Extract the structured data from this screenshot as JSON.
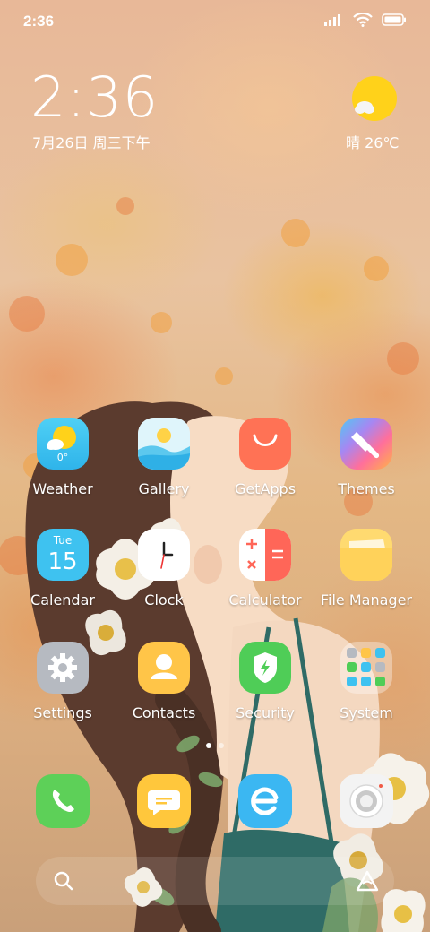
{
  "status_bar": {
    "time": "2:36",
    "icons": [
      "signal-icon",
      "wifi-icon",
      "battery-icon"
    ]
  },
  "clock_widget": {
    "time": "2:36",
    "date": "7月26日 周三下午"
  },
  "weather_widget": {
    "icon": "sunny-cloud-icon",
    "text": "晴 26℃"
  },
  "apps": [
    {
      "label": "Weather",
      "icon": "weather-icon",
      "badge": "0°"
    },
    {
      "label": "Gallery",
      "icon": "gallery-icon"
    },
    {
      "label": "GetApps",
      "icon": "getapps-icon"
    },
    {
      "label": "Themes",
      "icon": "themes-icon"
    },
    {
      "label": "Calendar",
      "icon": "calendar-icon",
      "day_name": "Tue",
      "day_number": "15"
    },
    {
      "label": "Clock",
      "icon": "clock-icon"
    },
    {
      "label": "Calculator",
      "icon": "calculator-icon"
    },
    {
      "label": "File Manager",
      "icon": "file-manager-icon"
    },
    {
      "label": "Settings",
      "icon": "settings-icon"
    },
    {
      "label": "Contacts",
      "icon": "contacts-icon"
    },
    {
      "label": "Security",
      "icon": "security-icon"
    },
    {
      "label": "System",
      "icon": "system-folder-icon"
    }
  ],
  "page_indicator": {
    "pages": 2,
    "current": 1
  },
  "dock": [
    {
      "icon": "phone-icon"
    },
    {
      "icon": "messages-icon"
    },
    {
      "icon": "browser-icon"
    },
    {
      "icon": "camera-icon"
    }
  ],
  "search_bar": {
    "left_icon": "search-icon",
    "right_icon": "assistant-icon"
  },
  "colors": {
    "weather": "#3fc1ee",
    "gallery": "#5fd0ef",
    "getapps": "#ff7557",
    "themes": "#ff6fa0",
    "calendar": "#46c3f1",
    "clock": "#ffffff",
    "calculator": "#ff6a5a",
    "file_manager": "#ffd86b",
    "settings": "#b5b9c0",
    "contacts": "#ffc64b",
    "security": "#53cf5b",
    "phone": "#5fd25a",
    "messages": "#ffc83d",
    "browser": "#3fb8f2",
    "camera": "#f2f2f2"
  }
}
